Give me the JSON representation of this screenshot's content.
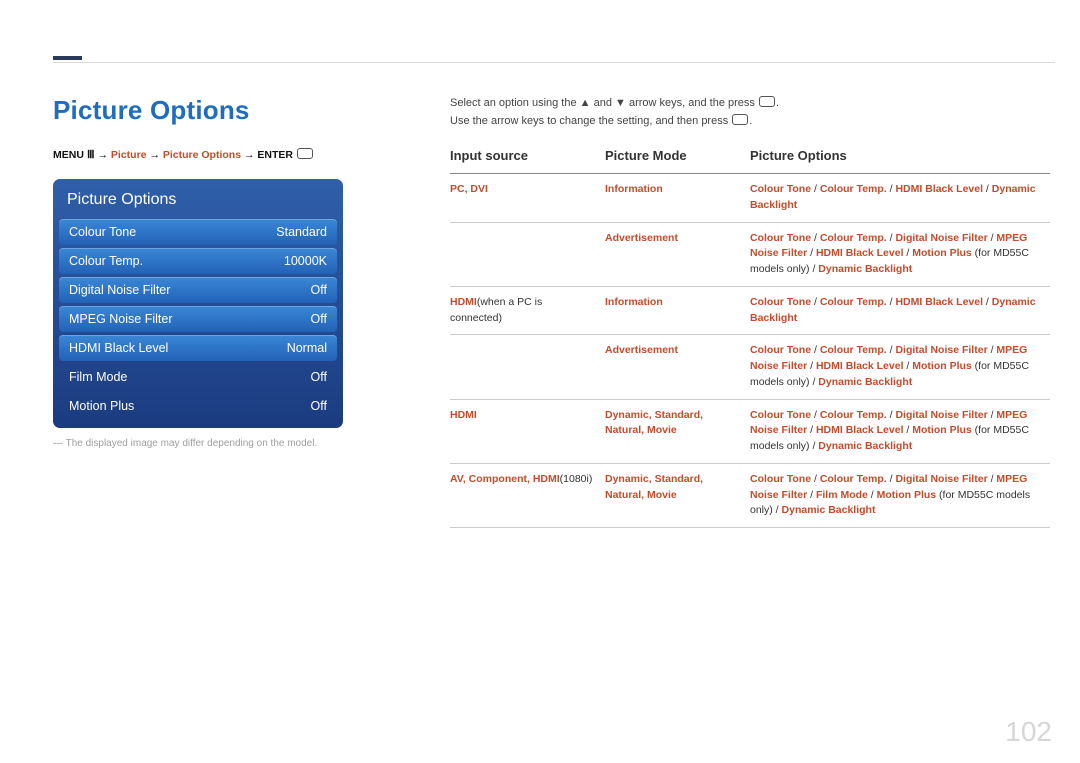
{
  "page_title": "Picture Options",
  "page_number": "102",
  "breadcrumb": {
    "prefix": "MENU",
    "hl1": "Picture",
    "hl2": "Picture Options",
    "suffix": "ENTER"
  },
  "panel": {
    "title": "Picture Options",
    "rows": [
      {
        "label": "Colour Tone",
        "value": "Standard"
      },
      {
        "label": "Colour Temp.",
        "value": "10000K"
      },
      {
        "label": "Digital Noise Filter",
        "value": "Off"
      },
      {
        "label": "MPEG Noise Filter",
        "value": "Off"
      },
      {
        "label": "HDMI Black Level",
        "value": "Normal"
      },
      {
        "label": "Film Mode",
        "value": "Off"
      },
      {
        "label": "Motion Plus",
        "value": "Off"
      }
    ]
  },
  "footnote": "― The displayed image may differ depending on the model.",
  "instructions": {
    "line1a": "Select an option using the ",
    "line1b": " and ",
    "line1c": " arrow keys, and the press ",
    "line1d": ".",
    "line2a": "Use the arrow keys to change the setting, and then press ",
    "line2b": "."
  },
  "table": {
    "headers": [
      "Input source",
      "Picture Mode",
      "Picture Options"
    ],
    "rows": [
      {
        "src_hl": "PC, DVI",
        "src_plain": "",
        "mode_hl": "Information",
        "mode_plain": "",
        "opts": [
          {
            "t": "Colour Tone",
            "c": "r"
          },
          {
            "t": " / ",
            "c": ""
          },
          {
            "t": "Colour Temp.",
            "c": "r"
          },
          {
            "t": " / ",
            "c": ""
          },
          {
            "t": "HDMI Black Level",
            "c": "r"
          },
          {
            "t": " / ",
            "c": ""
          },
          {
            "t": "Dynamic Backlight",
            "c": "r"
          }
        ]
      },
      {
        "src_hl": "",
        "src_plain": "",
        "mode_hl": "Advertisement",
        "mode_plain": "",
        "opts": [
          {
            "t": "Colour Tone",
            "c": "r"
          },
          {
            "t": " / ",
            "c": ""
          },
          {
            "t": "Colour Temp.",
            "c": "r"
          },
          {
            "t": " / ",
            "c": ""
          },
          {
            "t": "Digital Noise Filter",
            "c": "r"
          },
          {
            "t": " / ",
            "c": ""
          },
          {
            "t": "MPEG Noise Filter",
            "c": "r"
          },
          {
            "t": " / ",
            "c": ""
          },
          {
            "t": "HDMI Black Level",
            "c": "r"
          },
          {
            "t": " / ",
            "c": ""
          },
          {
            "t": "Motion Plus",
            "c": "r"
          },
          {
            "t": " (for MD55C models only) / ",
            "c": ""
          },
          {
            "t": "Dynamic Backlight",
            "c": "r"
          }
        ]
      },
      {
        "src_hl": "HDMI",
        "src_plain": "(when a PC is connected)",
        "mode_hl": "Information",
        "mode_plain": "",
        "opts": [
          {
            "t": "Colour Tone",
            "c": "r"
          },
          {
            "t": " / ",
            "c": ""
          },
          {
            "t": "Colour Temp.",
            "c": "r"
          },
          {
            "t": " / ",
            "c": ""
          },
          {
            "t": "HDMI Black Level",
            "c": "r"
          },
          {
            "t": " / ",
            "c": ""
          },
          {
            "t": "Dynamic Backlight",
            "c": "r"
          }
        ]
      },
      {
        "src_hl": "",
        "src_plain": "",
        "mode_hl": "Advertisement",
        "mode_plain": "",
        "opts": [
          {
            "t": "Colour Tone",
            "c": "r"
          },
          {
            "t": " / ",
            "c": ""
          },
          {
            "t": "Colour Temp.",
            "c": "r"
          },
          {
            "t": " / ",
            "c": ""
          },
          {
            "t": "Digital Noise Filter",
            "c": "r"
          },
          {
            "t": " / ",
            "c": ""
          },
          {
            "t": "MPEG Noise Filter",
            "c": "r"
          },
          {
            "t": " / ",
            "c": ""
          },
          {
            "t": "HDMI Black Level",
            "c": "r"
          },
          {
            "t": " / ",
            "c": ""
          },
          {
            "t": "Motion Plus",
            "c": "r"
          },
          {
            "t": " (for MD55C models only) / ",
            "c": ""
          },
          {
            "t": "Dynamic Backlight",
            "c": "r"
          }
        ]
      },
      {
        "src_hl": "HDMI",
        "src_plain": "",
        "mode_hl": "Dynamic, Standard, Natural, Movie",
        "mode_plain": "",
        "opts": [
          {
            "t": "Colour Tone",
            "c": "r"
          },
          {
            "t": " / ",
            "c": ""
          },
          {
            "t": "Colour Temp.",
            "c": "r"
          },
          {
            "t": " / ",
            "c": ""
          },
          {
            "t": "Digital Noise Filter",
            "c": "r"
          },
          {
            "t": " / ",
            "c": ""
          },
          {
            "t": "MPEG Noise Filter",
            "c": "r"
          },
          {
            "t": " / ",
            "c": ""
          },
          {
            "t": "HDMI Black Level",
            "c": "r"
          },
          {
            "t": " / ",
            "c": ""
          },
          {
            "t": "Motion Plus",
            "c": "r"
          },
          {
            "t": " (for MD55C models only) / ",
            "c": ""
          },
          {
            "t": "Dynamic Backlight",
            "c": "r"
          }
        ]
      },
      {
        "src_hl": "AV, Component, HDMI",
        "src_plain": "(1080i)",
        "mode_hl": "Dynamic, Standard, Natural, Movie",
        "mode_plain": "",
        "opts": [
          {
            "t": "Colour Tone",
            "c": "r"
          },
          {
            "t": " / ",
            "c": ""
          },
          {
            "t": "Colour Temp.",
            "c": "r"
          },
          {
            "t": " / ",
            "c": ""
          },
          {
            "t": "Digital Noise Filter",
            "c": "r"
          },
          {
            "t": " / ",
            "c": ""
          },
          {
            "t": "MPEG Noise Filter",
            "c": "r"
          },
          {
            "t": " / ",
            "c": ""
          },
          {
            "t": "Film Mode",
            "c": "r"
          },
          {
            "t": " / ",
            "c": ""
          },
          {
            "t": "Motion Plus",
            "c": "r"
          },
          {
            "t": " (for MD55C models only) / ",
            "c": ""
          },
          {
            "t": "Dynamic Backlight",
            "c": "r"
          }
        ]
      }
    ]
  }
}
